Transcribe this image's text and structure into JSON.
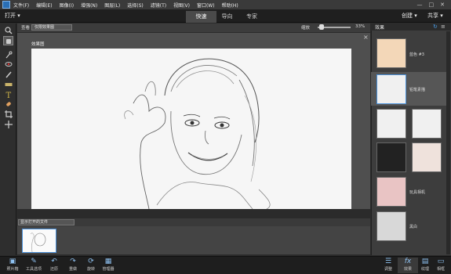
{
  "menubar": {
    "items": [
      "文件(F)",
      "编辑(E)",
      "图像(I)",
      "增强(N)",
      "图层(L)",
      "选择(S)",
      "滤镜(T)",
      "视图(V)",
      "窗口(W)",
      "帮助(H)"
    ],
    "window_controls": [
      "—",
      "□",
      "✕"
    ]
  },
  "modebar": {
    "open_label": "打开 ▾",
    "tabs": [
      "快速",
      "导向",
      "专家"
    ],
    "active_tab": "快速",
    "create_label": "创建 ▾",
    "share_label": "共享 ▾"
  },
  "options": {
    "view_label": "查看",
    "view_value": "仅限效果图",
    "zoom_label": "缩放",
    "zoom_value": "33%"
  },
  "canvas": {
    "doc_label": "效果图",
    "close": "×"
  },
  "photo_bin": {
    "select_value": "显示打开的文件"
  },
  "effects": {
    "title": "效果",
    "items": [
      {
        "label": "蓝色 #3"
      },
      {
        "label": "铅笔素描"
      },
      {
        "label": ""
      },
      {
        "label": ""
      },
      {
        "label": ""
      },
      {
        "label": ""
      },
      {
        "label": "玩具相机"
      },
      {
        "label": "黑白"
      }
    ]
  },
  "bottombar": {
    "left": [
      {
        "label": "照片箱",
        "icon": "photo-bin-icon"
      },
      {
        "label": "工具选项",
        "icon": "tool-options-icon"
      },
      {
        "label": "还原",
        "icon": "undo-icon"
      },
      {
        "label": "重做",
        "icon": "redo-icon"
      },
      {
        "label": "旋转",
        "icon": "rotate-icon"
      },
      {
        "label": "管理器",
        "icon": "organizer-icon"
      }
    ],
    "right": [
      {
        "label": "调整",
        "icon": "adjustments-icon"
      },
      {
        "label": "效果",
        "icon": "fx-icon"
      },
      {
        "label": "纹理",
        "icon": "textures-icon"
      },
      {
        "label": "相框",
        "icon": "frames-icon"
      }
    ]
  }
}
